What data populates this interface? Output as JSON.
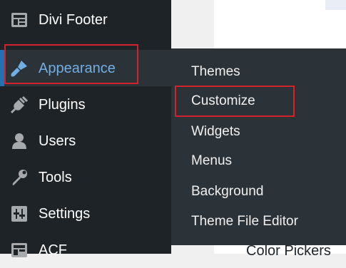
{
  "sidebar": {
    "items": [
      {
        "label": "Divi Footer",
        "icon": "layout-icon"
      },
      {
        "label": "Appearance",
        "icon": "brush-icon",
        "active": true
      },
      {
        "label": "Plugins",
        "icon": "plug-icon"
      },
      {
        "label": "Users",
        "icon": "user-icon"
      },
      {
        "label": "Tools",
        "icon": "wrench-icon"
      },
      {
        "label": "Settings",
        "icon": "sliders-icon"
      },
      {
        "label": "ACF",
        "icon": "layout-icon"
      }
    ]
  },
  "submenu": {
    "items": [
      {
        "label": "Themes"
      },
      {
        "label": "Customize",
        "highlighted": true
      },
      {
        "label": "Widgets"
      },
      {
        "label": "Menus"
      },
      {
        "label": "Background"
      },
      {
        "label": "Theme File Editor"
      }
    ]
  },
  "main": {
    "partial_heading": "Color Pickers"
  },
  "colors": {
    "sidebar_bg": "#1d2327",
    "flyout_bg": "#2c3338",
    "active_text": "#72aee6",
    "highlight": "#d3222a"
  }
}
